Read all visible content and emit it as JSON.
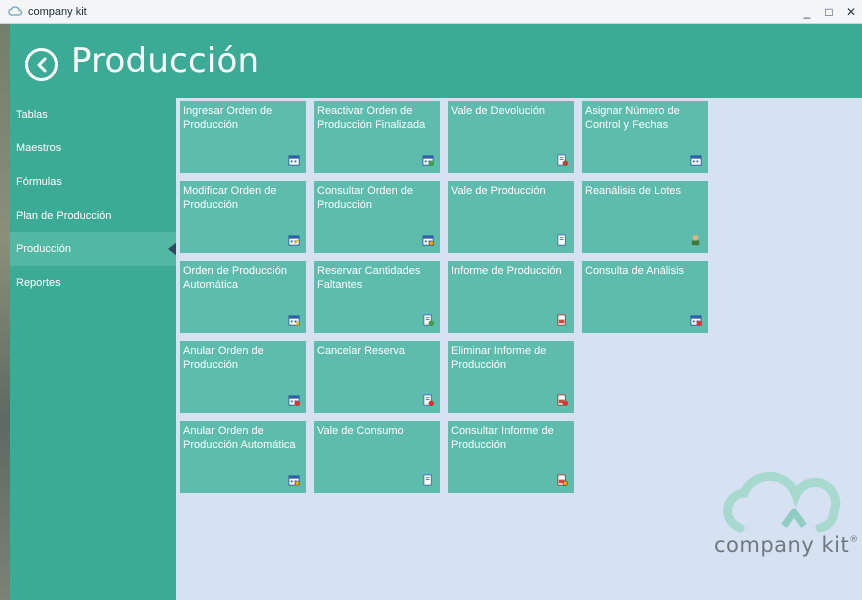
{
  "window": {
    "title": "company kit",
    "minimize": "_",
    "maximize": "□",
    "close": "✕"
  },
  "header": {
    "title": "Producción"
  },
  "sidebar": {
    "items": [
      {
        "label": "Tablas"
      },
      {
        "label": "Maestros"
      },
      {
        "label": "Fórmulas"
      },
      {
        "label": "Plan de Producción"
      },
      {
        "label": "Producción",
        "active": true
      },
      {
        "label": "Reportes"
      }
    ]
  },
  "tiles": [
    {
      "label": "Ingresar Orden de Producción",
      "icon": "calendar-icon"
    },
    {
      "label": "Reactivar Orden de Producción Finalizada",
      "icon": "calendar-refresh-icon"
    },
    {
      "label": "Vale de Devolución",
      "icon": "document-return-icon"
    },
    {
      "label": "Asignar Número de Control y Fechas",
      "icon": "calendar-number-icon"
    },
    {
      "label": "Modificar Orden de Producción",
      "icon": "calendar-edit-icon"
    },
    {
      "label": "Consultar Orden de Producción",
      "icon": "calendar-search-icon"
    },
    {
      "label": "Vale de Producción",
      "icon": "document-production-icon"
    },
    {
      "label": "Reanálisis de Lotes",
      "icon": "person-check-icon"
    },
    {
      "label": "Orden de Producción Automática",
      "icon": "calendar-star-icon"
    },
    {
      "label": "Reservar Cantidades Faltantes",
      "icon": "document-reserve-icon"
    },
    {
      "label": "Informe de Producción",
      "icon": "report-icon"
    },
    {
      "label": "Consulta de Análisis",
      "icon": "calendar-analysis-icon"
    },
    {
      "label": "Anular Orden de Producción",
      "icon": "calendar-cancel-icon"
    },
    {
      "label": "Cancelar Reserva",
      "icon": "document-cancel-icon"
    },
    {
      "label": "Eliminar Informe de Producción",
      "icon": "report-delete-icon"
    },
    null,
    {
      "label": "Anular Orden de Producción Automática",
      "icon": "calendar-star-cancel-icon"
    },
    {
      "label": "Vale de Consumo",
      "icon": "document-consumption-icon"
    },
    {
      "label": "Consultar Informe de Producción",
      "icon": "report-search-icon"
    }
  ],
  "logo": {
    "text": "company kit",
    "registered": "®"
  },
  "colors": {
    "accent": "#3cab96",
    "tile": "#5dbcac",
    "content_bg": "#d6e2f2"
  }
}
